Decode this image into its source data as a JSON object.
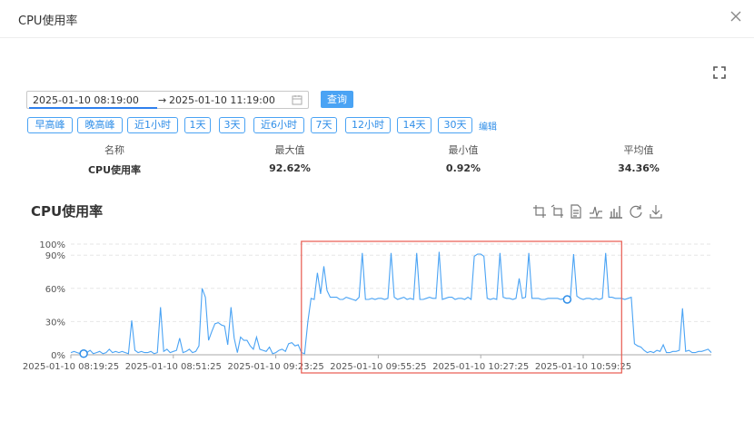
{
  "dialog": {
    "title": "CPU使用率"
  },
  "date_range": {
    "start": "2025-01-10 08:19:00",
    "separator": "→",
    "end": "2025-01-10 11:19:00"
  },
  "query_label": "查询",
  "quick_ranges": [
    "早高峰",
    "晚高峰",
    "近1小时",
    "1天",
    "3天",
    "近6小时",
    "7天",
    "12小时",
    "14天",
    "30天"
  ],
  "edit_label": "编辑",
  "stats_table": {
    "headers": [
      "名称",
      "最大值",
      "最小值",
      "平均值"
    ],
    "rows": [
      {
        "name": "CPU使用率",
        "max": "92.62%",
        "min": "0.92%",
        "avg": "34.36%"
      }
    ]
  },
  "chart_data": {
    "type": "line",
    "title": "CPU使用率",
    "xlabel": "",
    "ylabel": "",
    "y_tick_labels": [
      "0%",
      "30%",
      "60%",
      "90%",
      "100%"
    ],
    "y_ticks": [
      0,
      30,
      60,
      90,
      100
    ],
    "ylim": [
      0,
      100
    ],
    "x_tick_labels": [
      "2025-01-10 08:19:25",
      "2025-01-10 08:51:25",
      "2025-01-10 09:23:25",
      "2025-01-10 09:55:25",
      "2025-01-10 10:27:25",
      "2025-01-10 10:59:25"
    ],
    "grid": true,
    "color": "#4aa3f4",
    "highlight_color": "#e8594f",
    "series": [
      {
        "values": [
          2,
          3,
          2,
          1,
          1,
          2,
          4,
          1,
          2,
          3,
          1,
          2,
          5,
          2,
          3,
          2,
          3,
          2,
          1,
          31,
          4,
          2,
          3,
          2,
          2,
          3,
          1,
          2,
          43,
          3,
          5,
          2,
          3,
          4,
          15,
          2,
          3,
          5,
          2,
          3,
          8,
          60,
          52,
          13,
          21,
          28,
          29,
          27,
          26,
          9,
          43,
          15,
          2,
          16,
          13,
          13,
          8,
          5,
          16,
          5,
          4,
          3,
          7,
          1,
          2,
          4,
          5,
          3,
          10,
          11,
          8,
          9,
          2,
          1,
          30,
          51,
          50,
          74,
          55,
          80,
          58,
          52,
          52,
          52,
          50,
          50,
          52,
          51,
          50,
          49,
          52,
          92,
          50,
          50,
          51,
          50,
          51,
          51,
          50,
          51,
          92,
          52,
          50,
          51,
          52,
          50,
          51,
          50,
          92,
          50,
          50,
          51,
          52,
          51,
          51,
          93,
          50,
          51,
          52,
          52,
          50,
          51,
          51,
          50,
          52,
          50,
          89,
          91,
          91,
          89,
          51,
          50,
          51,
          50,
          92,
          52,
          51,
          51,
          50,
          51,
          69,
          51,
          52,
          92,
          51,
          51,
          51,
          50,
          50,
          51,
          51,
          51,
          51,
          50,
          51,
          50,
          51,
          91,
          53,
          51,
          50,
          51,
          51,
          50,
          51,
          50,
          51,
          92,
          52,
          52,
          51,
          51,
          51,
          50,
          51,
          52,
          10,
          8,
          7,
          4,
          2,
          3,
          2,
          4,
          3,
          9,
          2,
          2,
          3,
          3,
          4,
          42,
          3,
          4,
          2,
          2,
          3,
          3,
          4,
          5,
          2
        ],
        "max_marker_index": 155,
        "min_marker_index": 4
      }
    ],
    "highlight_range": {
      "start_index": 72,
      "end_index": 172
    }
  },
  "icons": {
    "close": "close-icon",
    "fullscreen": "fullscreen-icon",
    "calendar": "calendar-icon",
    "toolbox": [
      "zoom-select-icon",
      "zoom-reset-icon",
      "data-view-icon",
      "line-chart-icon",
      "bar-chart-icon",
      "restore-icon",
      "download-icon"
    ]
  }
}
